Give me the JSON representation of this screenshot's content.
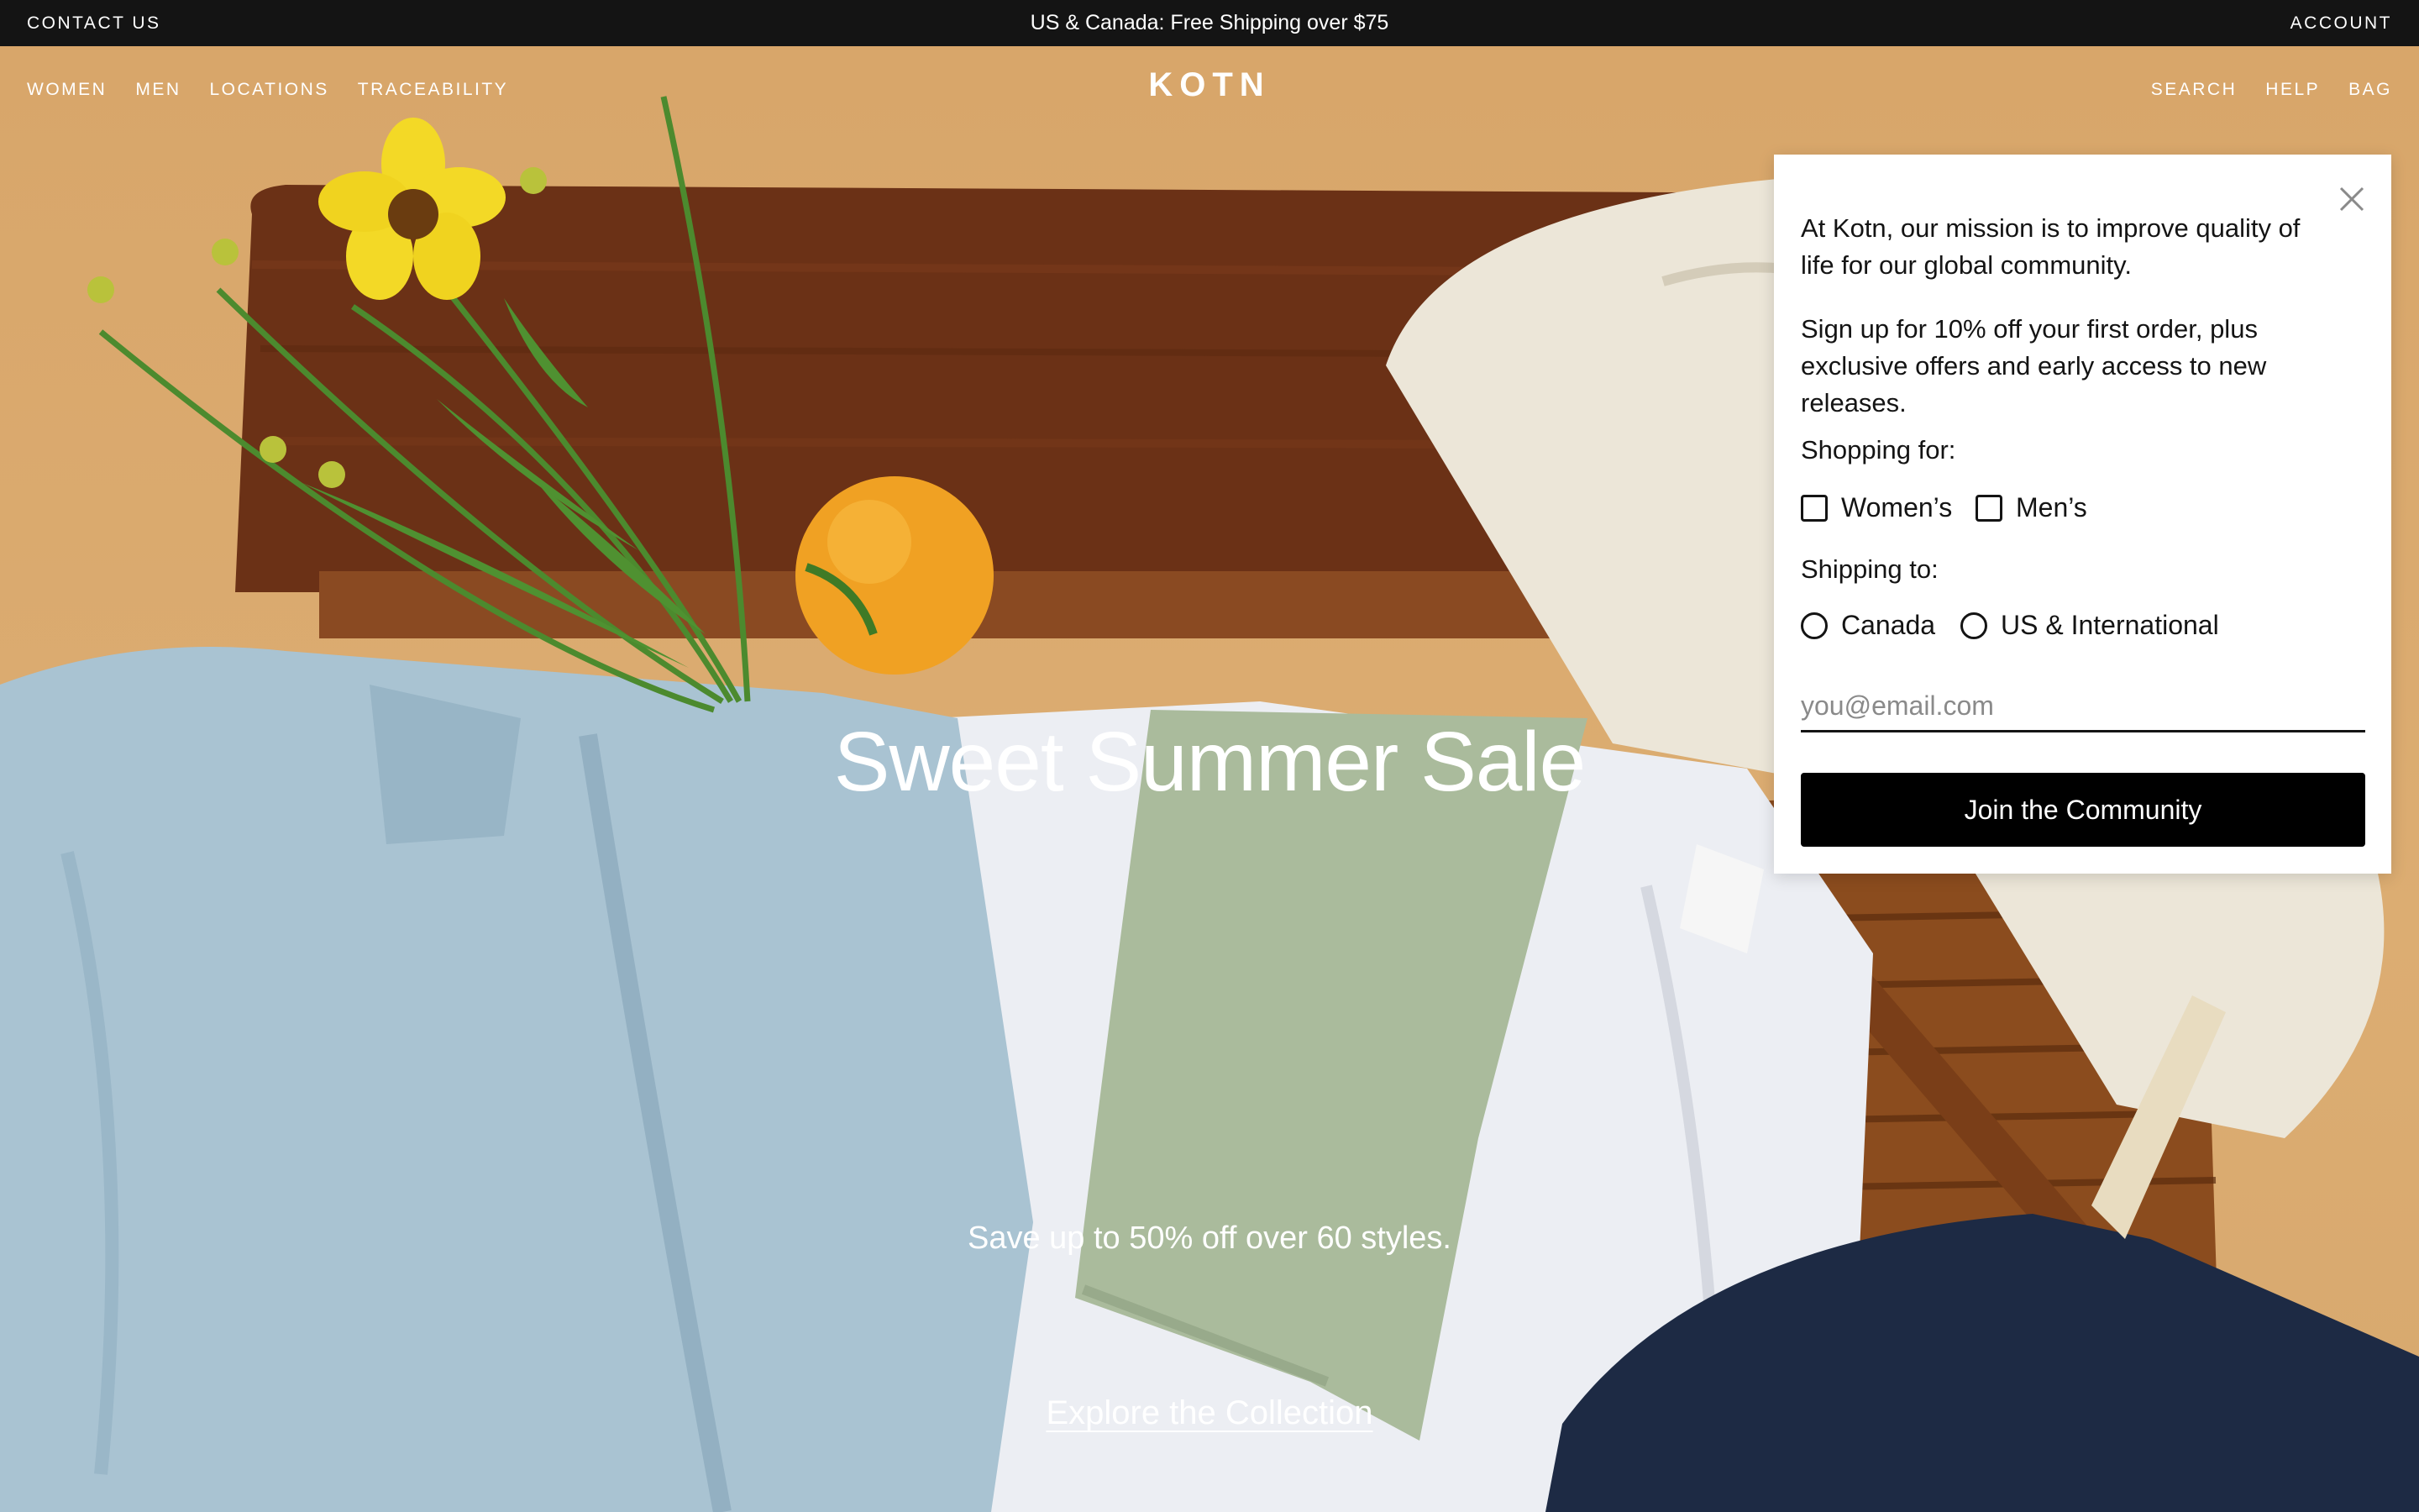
{
  "announcement": {
    "contact": "CONTACT US",
    "promo": "US & Canada: Free Shipping over $75",
    "account": "ACCOUNT"
  },
  "nav": {
    "left": [
      "WOMEN",
      "MEN",
      "LOCATIONS",
      "TRACEABILITY"
    ],
    "right": [
      "SEARCH",
      "HELP",
      "BAG"
    ],
    "logo": "KOTN"
  },
  "hero": {
    "title": "Sweet Summer Sale",
    "subtitle": "Save up to 50% off over 60 styles.",
    "cta": "Explore the Collection"
  },
  "popup": {
    "mission": "At Kotn, our mission is to improve quality of life for our global community.",
    "offer": "Sign up for 10% off your first order, plus exclusive offers and early access to new releases.",
    "shopping_label": "Shopping for:",
    "shopping_options": [
      "Women’s",
      "Men’s"
    ],
    "shipping_label": "Shipping to:",
    "shipping_options": [
      "Canada",
      "US & International"
    ],
    "email_placeholder": "you@email.com",
    "join_button": "Join the Community",
    "close_icon": "close-icon"
  },
  "colors": {
    "background": "#d9aa6b",
    "topbar": "#141414",
    "button": "#000000"
  }
}
